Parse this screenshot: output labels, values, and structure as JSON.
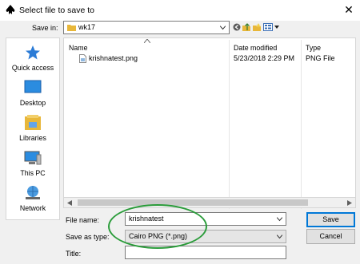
{
  "window": {
    "title": "Select file to save to",
    "close_glyph": "✕"
  },
  "save_in": {
    "label": "Save in:",
    "folder": "wk17"
  },
  "places": [
    {
      "label": "Quick access",
      "icon": "star-icon"
    },
    {
      "label": "Desktop",
      "icon": "desktop-icon"
    },
    {
      "label": "Libraries",
      "icon": "libraries-icon"
    },
    {
      "label": "This PC",
      "icon": "computer-icon"
    },
    {
      "label": "Network",
      "icon": "network-icon"
    }
  ],
  "columns": {
    "name": "Name",
    "date": "Date modified",
    "type": "Type"
  },
  "files": [
    {
      "name": "krishnatest.png",
      "date": "5/23/2018 2:29 PM",
      "type": "PNG File"
    }
  ],
  "form": {
    "filename_label": "File name:",
    "filename_value": "krishnatest",
    "savetype_label": "Save as type:",
    "savetype_value": "Cairo PNG (*.png)",
    "title_label": "Title:",
    "title_value": ""
  },
  "buttons": {
    "save": "Save",
    "cancel": "Cancel"
  },
  "colors": {
    "annotation_ellipse": "#2a9c3a",
    "accent": "#0078d7"
  }
}
